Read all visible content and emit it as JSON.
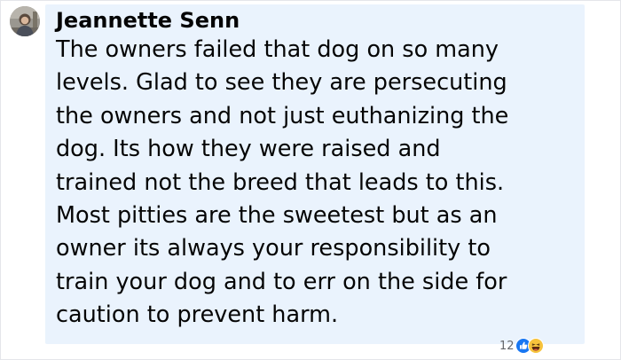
{
  "comment": {
    "author": "Jeannette Senn",
    "text_lines": [
      "The owners failed that dog on so many",
      "levels. Glad to see they are persecuting",
      "the owners and not just euthanizing the",
      "dog. Its how they were raised and",
      "trained not the breed that leads to this.",
      "Most pitties are the sweetest but as an",
      "owner its always your responsibility to",
      "train your dog and to err on the side for",
      "caution to prevent harm."
    ],
    "reactions": {
      "count": "12",
      "icons": [
        "like-icon",
        "haha-icon"
      ]
    }
  },
  "colors": {
    "bubble_background": "#eaf3fd",
    "text": "#050505",
    "like_blue": "#1877f2",
    "haha_yellow": "#f7c33c"
  }
}
